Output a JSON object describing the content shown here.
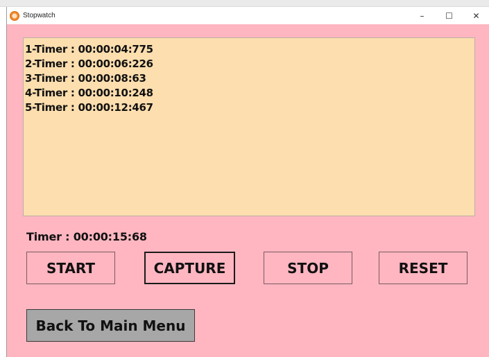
{
  "window": {
    "title": "Stopwatch",
    "minimize": "–",
    "maximize": "☐",
    "close": "✕"
  },
  "laps": [
    "1-Timer : 00:00:04:775",
    "2-Timer : 00:00:06:226",
    "3-Timer : 00:00:08:63",
    "4-Timer : 00:00:10:248",
    "5-Timer : 00:00:12:467"
  ],
  "timer": {
    "text": "Timer : 00:00:15:68"
  },
  "buttons": {
    "start": "START",
    "capture": "CAPTURE",
    "stop": "STOP",
    "reset": "RESET",
    "back": "Back To Main Menu"
  },
  "colors": {
    "window_bg": "#ffb6c1",
    "log_bg": "#fddeae",
    "back_button_bg": "#a7a7a7"
  }
}
